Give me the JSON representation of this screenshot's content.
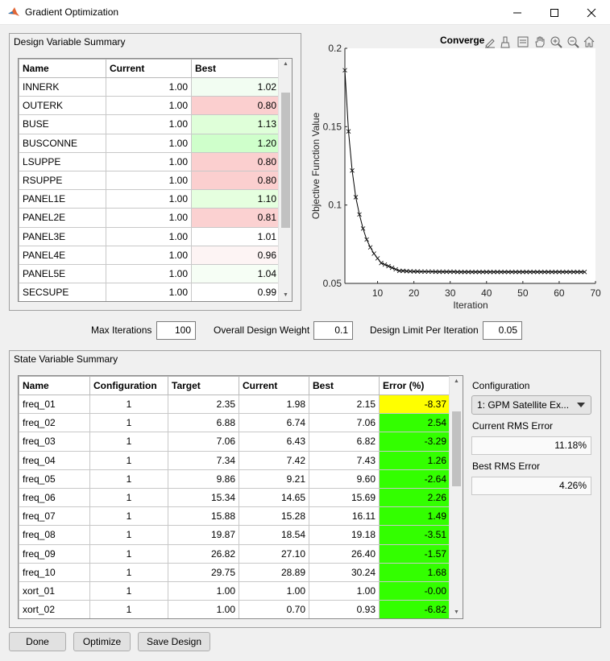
{
  "window": {
    "title": "Gradient Optimization"
  },
  "design": {
    "panel_title": "Design Variable Summary",
    "columns": [
      "Name",
      "Current",
      "Best"
    ],
    "rows": [
      {
        "name": "INNERK",
        "current": "1.00",
        "best": "1.02",
        "color": "#f2fdf2"
      },
      {
        "name": "OUTERK",
        "current": "1.00",
        "best": "0.80",
        "color": "#fbcfcf"
      },
      {
        "name": "BUSE",
        "current": "1.00",
        "best": "1.13",
        "color": "#dfffd9"
      },
      {
        "name": "BUSCONNE",
        "current": "1.00",
        "best": "1.20",
        "color": "#cfffcb"
      },
      {
        "name": "LSUPPE",
        "current": "1.00",
        "best": "0.80",
        "color": "#fbcfcf"
      },
      {
        "name": "RSUPPE",
        "current": "1.00",
        "best": "0.80",
        "color": "#fbcfcf"
      },
      {
        "name": "PANEL1E",
        "current": "1.00",
        "best": "1.10",
        "color": "#e5ffdf"
      },
      {
        "name": "PANEL2E",
        "current": "1.00",
        "best": "0.81",
        "color": "#fbd1d1"
      },
      {
        "name": "PANEL3E",
        "current": "1.00",
        "best": "1.01",
        "color": "#ffffff"
      },
      {
        "name": "PANEL4E",
        "current": "1.00",
        "best": "0.96",
        "color": "#fdf4f4"
      },
      {
        "name": "PANEL5E",
        "current": "1.00",
        "best": "1.04",
        "color": "#f6fef5"
      },
      {
        "name": "SECSUPE",
        "current": "1.00",
        "best": "0.99",
        "color": "#ffffff"
      }
    ]
  },
  "chart_data": {
    "type": "line",
    "title": "Converge",
    "xlabel": "Iteration",
    "ylabel": "Objective Function Value",
    "xlim": [
      1,
      70
    ],
    "ylim": [
      0.05,
      0.2
    ],
    "xticks": [
      10,
      20,
      30,
      40,
      50,
      60,
      70
    ],
    "yticks": [
      0.05,
      0.1,
      0.15,
      0.2
    ],
    "marker": "x",
    "series": [
      {
        "x": [
          1,
          2,
          3,
          4,
          5,
          6,
          7,
          8,
          9,
          10,
          11,
          12,
          13,
          14,
          15,
          16,
          17,
          18,
          19,
          20,
          21,
          22,
          23,
          24,
          25,
          26,
          27,
          28,
          29,
          30,
          31,
          32,
          33,
          34,
          35,
          36,
          37,
          38,
          39,
          40,
          41,
          42,
          43,
          44,
          45,
          46,
          47,
          48,
          49,
          50,
          51,
          52,
          53,
          54,
          55,
          56,
          57,
          58,
          59,
          60,
          61,
          62,
          63,
          64,
          65,
          66,
          67
        ],
        "values": [
          0.186,
          0.147,
          0.122,
          0.105,
          0.094,
          0.085,
          0.078,
          0.073,
          0.069,
          0.066,
          0.063,
          0.062,
          0.061,
          0.06,
          0.059,
          0.058,
          0.058,
          0.0578,
          0.0577,
          0.0576,
          0.0576,
          0.0575,
          0.0575,
          0.0575,
          0.0575,
          0.0574,
          0.0574,
          0.0574,
          0.0574,
          0.0574,
          0.0574,
          0.0573,
          0.0573,
          0.0573,
          0.0573,
          0.0573,
          0.0573,
          0.0573,
          0.0573,
          0.0573,
          0.0573,
          0.0573,
          0.0573,
          0.0573,
          0.0573,
          0.0573,
          0.0573,
          0.0573,
          0.0573,
          0.0573,
          0.0573,
          0.0573,
          0.0573,
          0.0573,
          0.0573,
          0.0573,
          0.0573,
          0.0573,
          0.0573,
          0.0573,
          0.0573,
          0.0573,
          0.0573,
          0.0573,
          0.0573,
          0.0573,
          0.0573
        ]
      }
    ]
  },
  "controls": {
    "max_iter_label": "Max Iterations",
    "max_iter": "100",
    "weight_label": "Overall Design Weight",
    "weight": "0.1",
    "limit_label": "Design Limit Per Iteration",
    "limit": "0.05"
  },
  "state": {
    "panel_title": "State Variable Summary",
    "columns": [
      "Name",
      "Configuration",
      "Target",
      "Current",
      "Best",
      "Error (%)"
    ],
    "rows": [
      {
        "name": "freq_01",
        "config": "1",
        "target": "2.35",
        "current": "1.98",
        "best": "2.15",
        "error": "-8.37",
        "color": "#ffff00"
      },
      {
        "name": "freq_02",
        "config": "1",
        "target": "6.88",
        "current": "6.74",
        "best": "7.06",
        "error": "2.54",
        "color": "#33ff00"
      },
      {
        "name": "freq_03",
        "config": "1",
        "target": "7.06",
        "current": "6.43",
        "best": "6.82",
        "error": "-3.29",
        "color": "#33ff00"
      },
      {
        "name": "freq_04",
        "config": "1",
        "target": "7.34",
        "current": "7.42",
        "best": "7.43",
        "error": "1.26",
        "color": "#33ff00"
      },
      {
        "name": "freq_05",
        "config": "1",
        "target": "9.86",
        "current": "9.21",
        "best": "9.60",
        "error": "-2.64",
        "color": "#33ff00"
      },
      {
        "name": "freq_06",
        "config": "1",
        "target": "15.34",
        "current": "14.65",
        "best": "15.69",
        "error": "2.26",
        "color": "#33ff00"
      },
      {
        "name": "freq_07",
        "config": "1",
        "target": "15.88",
        "current": "15.28",
        "best": "16.11",
        "error": "1.49",
        "color": "#33ff00"
      },
      {
        "name": "freq_08",
        "config": "1",
        "target": "19.87",
        "current": "18.54",
        "best": "19.18",
        "error": "-3.51",
        "color": "#33ff00"
      },
      {
        "name": "freq_09",
        "config": "1",
        "target": "26.82",
        "current": "27.10",
        "best": "26.40",
        "error": "-1.57",
        "color": "#33ff00"
      },
      {
        "name": "freq_10",
        "config": "1",
        "target": "29.75",
        "current": "28.89",
        "best": "30.24",
        "error": "1.68",
        "color": "#33ff00"
      },
      {
        "name": "xort_01",
        "config": "1",
        "target": "1.00",
        "current": "1.00",
        "best": "1.00",
        "error": "-0.00",
        "color": "#33ff00"
      },
      {
        "name": "xort_02",
        "config": "1",
        "target": "1.00",
        "current": "0.70",
        "best": "0.93",
        "error": "-6.82",
        "color": "#33ff00"
      }
    ]
  },
  "side": {
    "config_label": "Configuration",
    "config_value": "1: GPM Satellite Ex...",
    "current_rms_label": "Current RMS Error",
    "current_rms": "11.18%",
    "best_rms_label": "Best RMS Error",
    "best_rms": "4.26%"
  },
  "buttons": {
    "done": "Done",
    "optimize": "Optimize",
    "save": "Save Design"
  }
}
